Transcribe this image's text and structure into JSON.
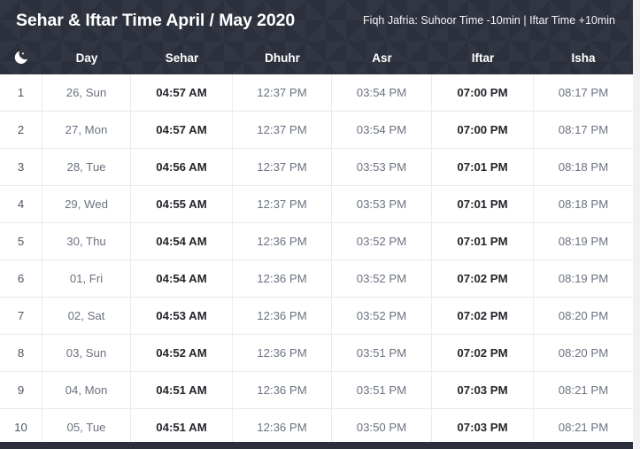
{
  "header": {
    "title": "Sehar & Iftar Time April / May 2020",
    "note": "Fiqh Jafria: Suhoor Time -10min | Iftar Time +10min",
    "icon": "crescent-moon-star-icon",
    "columns": [
      {
        "key": "index",
        "label": ""
      },
      {
        "key": "day",
        "label": "Day"
      },
      {
        "key": "sehar",
        "label": "Sehar"
      },
      {
        "key": "dhuhr",
        "label": "Dhuhr"
      },
      {
        "key": "asr",
        "label": "Asr"
      },
      {
        "key": "iftar",
        "label": "Iftar"
      },
      {
        "key": "isha",
        "label": "Isha"
      }
    ]
  },
  "colors": {
    "header_bg": "#2b303c",
    "header_text": "#ffffff",
    "row_text": "#6b7280",
    "highlight_text": "#24262b",
    "row_border": "#e9e9e9",
    "page_bg": "#f1f1f1"
  },
  "rows": [
    {
      "index": "1",
      "day": "26, Sun",
      "sehar": "04:57 AM",
      "dhuhr": "12:37 PM",
      "asr": "03:54 PM",
      "iftar": "07:00 PM",
      "isha": "08:17 PM"
    },
    {
      "index": "2",
      "day": "27, Mon",
      "sehar": "04:57 AM",
      "dhuhr": "12:37 PM",
      "asr": "03:54 PM",
      "iftar": "07:00 PM",
      "isha": "08:17 PM"
    },
    {
      "index": "3",
      "day": "28, Tue",
      "sehar": "04:56 AM",
      "dhuhr": "12:37 PM",
      "asr": "03:53 PM",
      "iftar": "07:01 PM",
      "isha": "08:18 PM"
    },
    {
      "index": "4",
      "day": "29, Wed",
      "sehar": "04:55 AM",
      "dhuhr": "12:37 PM",
      "asr": "03:53 PM",
      "iftar": "07:01 PM",
      "isha": "08:18 PM"
    },
    {
      "index": "5",
      "day": "30, Thu",
      "sehar": "04:54 AM",
      "dhuhr": "12:36 PM",
      "asr": "03:52 PM",
      "iftar": "07:01 PM",
      "isha": "08:19 PM"
    },
    {
      "index": "6",
      "day": "01, Fri",
      "sehar": "04:54 AM",
      "dhuhr": "12:36 PM",
      "asr": "03:52 PM",
      "iftar": "07:02 PM",
      "isha": "08:19 PM"
    },
    {
      "index": "7",
      "day": "02, Sat",
      "sehar": "04:53 AM",
      "dhuhr": "12:36 PM",
      "asr": "03:52 PM",
      "iftar": "07:02 PM",
      "isha": "08:20 PM"
    },
    {
      "index": "8",
      "day": "03, Sun",
      "sehar": "04:52 AM",
      "dhuhr": "12:36 PM",
      "asr": "03:51 PM",
      "iftar": "07:02 PM",
      "isha": "08:20 PM"
    },
    {
      "index": "9",
      "day": "04, Mon",
      "sehar": "04:51 AM",
      "dhuhr": "12:36 PM",
      "asr": "03:51 PM",
      "iftar": "07:03 PM",
      "isha": "08:21 PM"
    },
    {
      "index": "10",
      "day": "05, Tue",
      "sehar": "04:51 AM",
      "dhuhr": "12:36 PM",
      "asr": "03:50 PM",
      "iftar": "07:03 PM",
      "isha": "08:21 PM"
    }
  ]
}
